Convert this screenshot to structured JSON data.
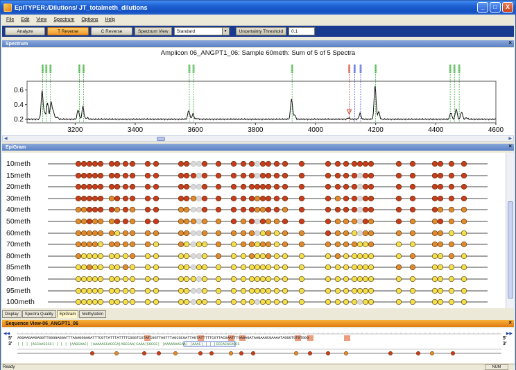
{
  "window": {
    "title": "EpiTYPER:/Dilutions/ JT_totalmeth_dilutions",
    "minimize_glyph": "_",
    "maximize_glyph": "□",
    "close_glyph": "X"
  },
  "menu": [
    "File",
    "Edit",
    "View",
    "Spectrum",
    "Options",
    "Help"
  ],
  "toolbar": {
    "analyze": "Analyze",
    "t_reverse": "T Reverse",
    "c_reverse": "C Reverse",
    "spectrum_view_label": "Spectrum View",
    "spectrum_view_value": "Standard",
    "uncertainty_label": "Uncertainty Threshold",
    "uncertainty_value": "0.1"
  },
  "spectrum_panel": {
    "header": "Spectrum",
    "title": "Amplicon 06_ANGPT1_06: Sample 60meth: Sum of 5 of 5 Spectra"
  },
  "chart_data": {
    "type": "line",
    "title": "Amplicon 06_ANGPT1_06: Sample 60meth: Sum of 5 of 5 Spectra",
    "xlabel": "",
    "ylabel": "",
    "xlim": [
      3040,
      4600
    ],
    "ylim": [
      0.15,
      0.72
    ],
    "x_ticks": [
      3200,
      3400,
      3600,
      3800,
      4000,
      4200,
      4400,
      4600
    ],
    "y_ticks": [
      0.2,
      0.4,
      0.6
    ],
    "peaks": [
      {
        "x": 3090,
        "y": 0.58
      },
      {
        "x": 3098,
        "y": 0.28
      },
      {
        "x": 3108,
        "y": 0.42
      },
      {
        "x": 3120,
        "y": 0.44
      },
      {
        "x": 3128,
        "y": 0.3
      },
      {
        "x": 3140,
        "y": 0.23
      },
      {
        "x": 3210,
        "y": 0.33
      },
      {
        "x": 3226,
        "y": 0.37
      },
      {
        "x": 3240,
        "y": 0.22
      },
      {
        "x": 3578,
        "y": 0.32
      },
      {
        "x": 3592,
        "y": 0.27
      },
      {
        "x": 3606,
        "y": 0.21
      },
      {
        "x": 3920,
        "y": 0.48
      },
      {
        "x": 3930,
        "y": 0.26
      },
      {
        "x": 4110,
        "y": 0.22
      },
      {
        "x": 4148,
        "y": 0.28
      },
      {
        "x": 4198,
        "y": 0.66
      },
      {
        "x": 4210,
        "y": 0.3
      },
      {
        "x": 4450,
        "y": 0.29
      },
      {
        "x": 4468,
        "y": 0.34
      },
      {
        "x": 4486,
        "y": 0.3
      },
      {
        "x": 4502,
        "y": 0.22
      }
    ],
    "markers": [
      {
        "x": 3092,
        "color": "#2faa2f"
      },
      {
        "x": 3104,
        "color": "#2faa2f"
      },
      {
        "x": 3118,
        "color": "#2faa2f"
      },
      {
        "x": 3214,
        "color": "#2faa2f"
      },
      {
        "x": 3228,
        "color": "#2faa2f"
      },
      {
        "x": 3580,
        "color": "#2faa2f"
      },
      {
        "x": 3594,
        "color": "#2faa2f"
      },
      {
        "x": 3922,
        "color": "#2faa2f"
      },
      {
        "x": 4112,
        "color": "#d23b2b"
      },
      {
        "x": 4130,
        "color": "#3b4ad6"
      },
      {
        "x": 4150,
        "color": "#3b4ad6"
      },
      {
        "x": 4200,
        "color": "#2faa2f"
      },
      {
        "x": 4448,
        "color": "#2faa2f"
      },
      {
        "x": 4462,
        "color": "#2faa2f"
      },
      {
        "x": 4478,
        "color": "#2faa2f"
      }
    ]
  },
  "epigram": {
    "header": "EpiGram",
    "cpg_count": 32,
    "samples": [
      {
        "name": "10meth",
        "level": 0.1
      },
      {
        "name": "15meth",
        "level": 0.15
      },
      {
        "name": "20meth",
        "level": 0.2
      },
      {
        "name": "30meth",
        "level": 0.3
      },
      {
        "name": "40meth",
        "level": 0.4
      },
      {
        "name": "50meth",
        "level": 0.5
      },
      {
        "name": "60meth",
        "level": 0.6
      },
      {
        "name": "70meth",
        "level": 0.7
      },
      {
        "name": "80meth",
        "level": 0.8
      },
      {
        "name": "85meth",
        "level": 0.85
      },
      {
        "name": "90meth",
        "level": 0.9
      },
      {
        "name": "95meth",
        "level": 0.95
      },
      {
        "name": "100meth",
        "level": 1.0
      }
    ],
    "colors": {
      "low": "#c83b1c",
      "mid": "#e08a2c",
      "high": "#f2e04a",
      "none": "#d8d8d8"
    }
  },
  "tabs": [
    "Display",
    "Spectra Quality",
    "EpiGram",
    "Methylation"
  ],
  "sequence_view": {
    "header": "Sequence View-06_ANGPT1_06",
    "strand5": "5'",
    "strand3": "3'",
    "sequence": "AGGAAGAAGAGGTTGGGGAGGATTTAGAGGGAGATTTCGTTATTTATTTTCGGGTCGTATCGGTTAGTTTAGCGCGATTAGTATTTTTCGTTACGAATTTGAGAGATAAGAAGCGAAAATAGGGTGTGTGGG",
    "fragments": "|  |  |  |ACCAACCCC|  |  |   |  |AAGCAAC|  |AAAAACCACCCA|AGCCAA|CAAA|CGCCC|  |AAAAAAACAA|  |AAAC|  |  |  |CCCACACACCC"
  },
  "status": {
    "left": "Ready",
    "right": "NUM"
  }
}
